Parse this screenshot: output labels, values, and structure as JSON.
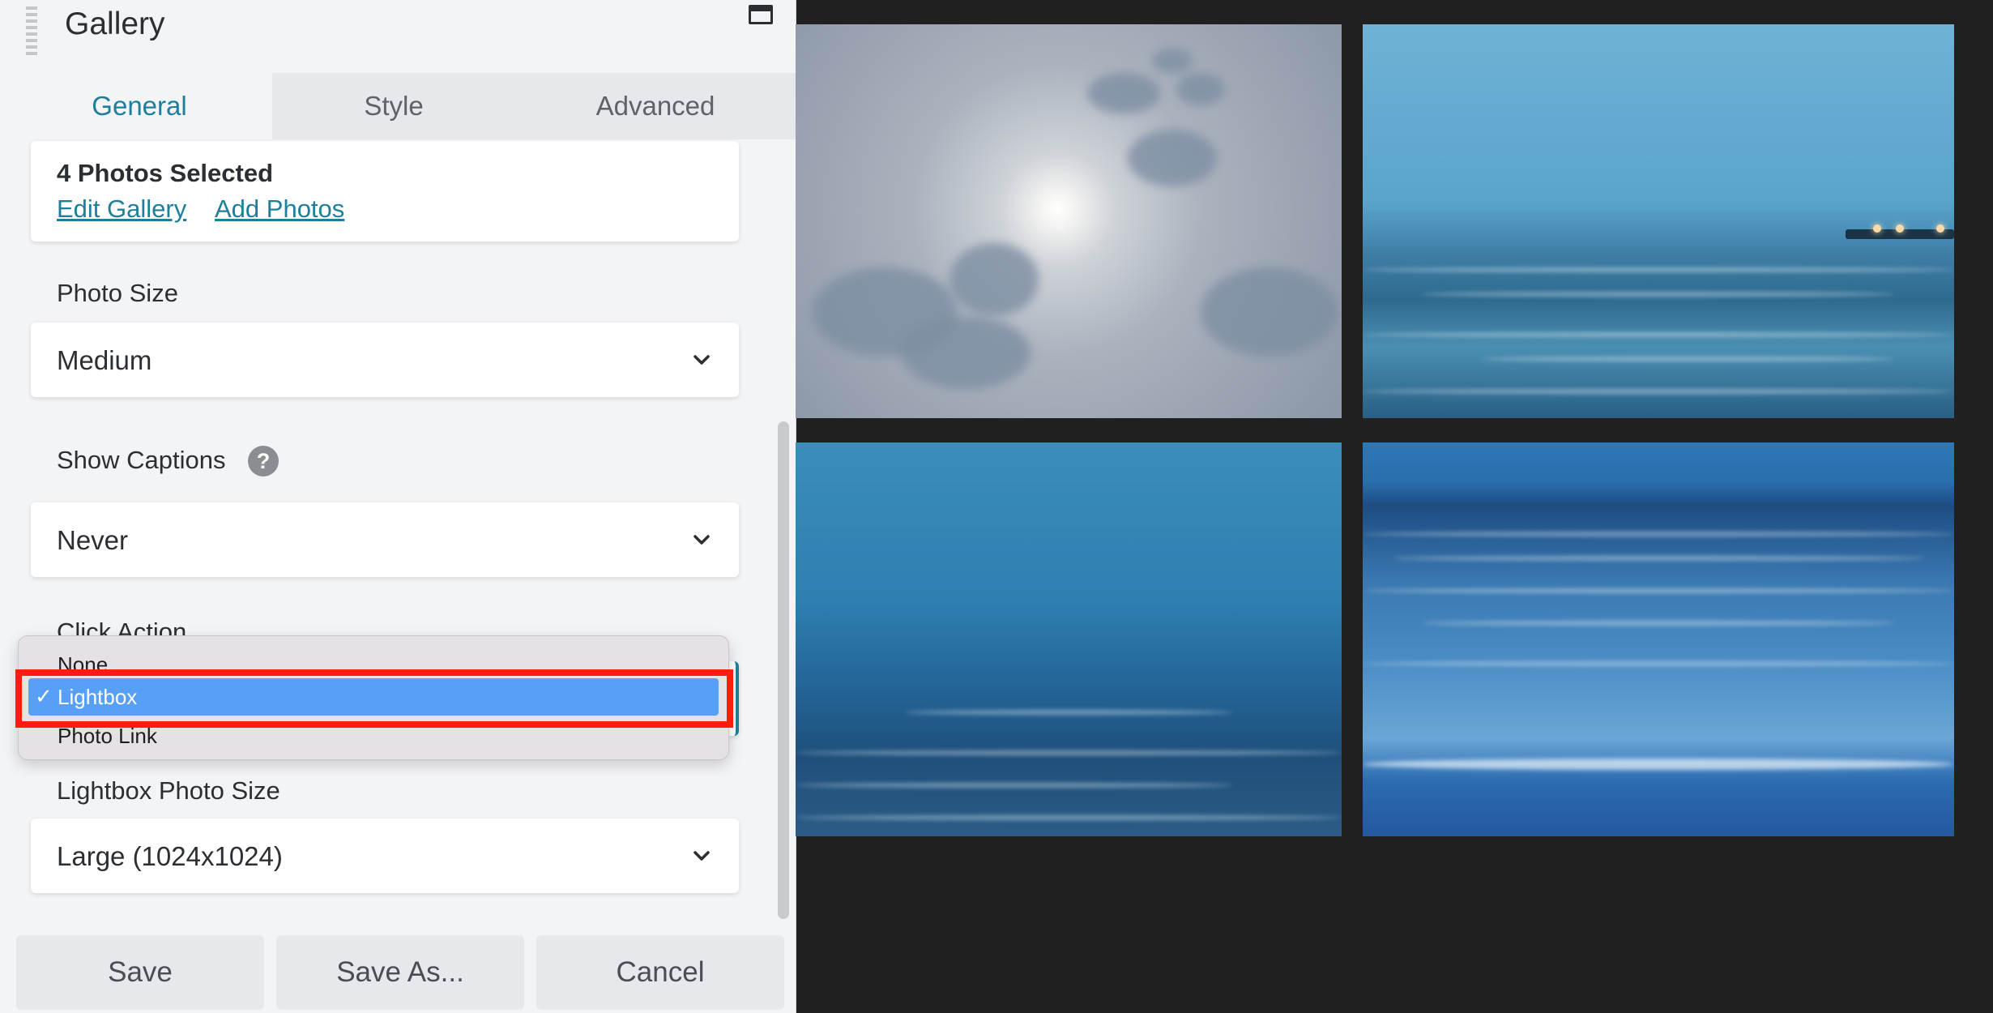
{
  "panel": {
    "title": "Gallery",
    "tabs": [
      {
        "label": "General",
        "active": true
      },
      {
        "label": "Style",
        "active": false
      },
      {
        "label": "Advanced",
        "active": false
      }
    ],
    "photos_card": {
      "title": "4 Photos Selected",
      "edit_link": "Edit Gallery",
      "add_link": "Add Photos"
    },
    "photo_size": {
      "label": "Photo Size",
      "value": "Medium"
    },
    "show_captions": {
      "label": "Show Captions",
      "help_icon": "?",
      "value": "Never"
    },
    "click_action": {
      "label": "Click Action",
      "options": [
        "None",
        "Lightbox",
        "Photo Link"
      ],
      "selected": "Lightbox",
      "check_mark": "✓"
    },
    "lightbox_photo_size": {
      "label": "Lightbox Photo Size",
      "value": "Large (1024x1024)"
    },
    "footer": {
      "save": "Save",
      "save_as": "Save As...",
      "cancel": "Cancel"
    }
  },
  "colors": {
    "accent": "#1e7f9c",
    "highlight_box": "#fe1d09",
    "dropdown_selected": "#58a0f7",
    "preview_background": "#202020"
  },
  "icons": [
    "drag-handle-icon",
    "window-icon",
    "help-icon",
    "chevron-down-icon",
    "checkmark-icon"
  ]
}
